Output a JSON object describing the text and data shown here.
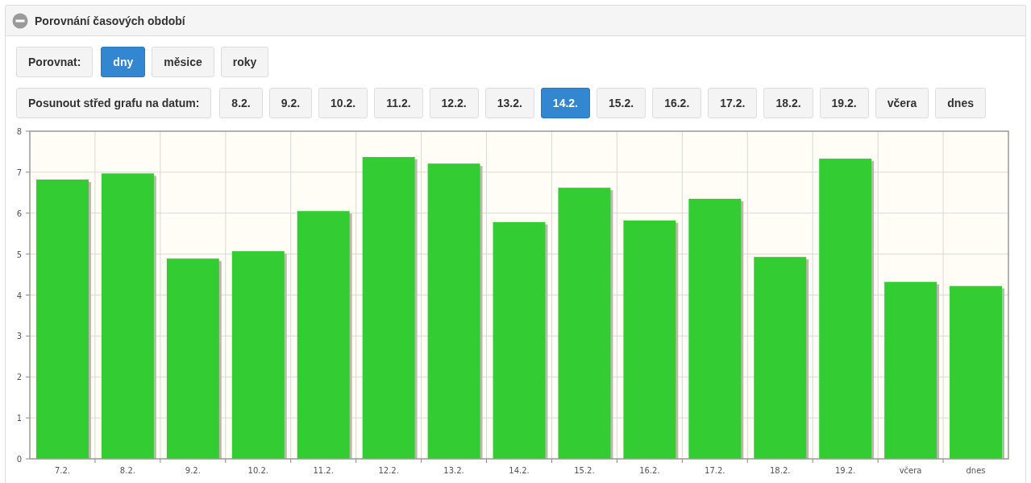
{
  "panel": {
    "title": "Porovnání časových období",
    "expanded": true
  },
  "compare": {
    "label": "Porovnat:",
    "options": [
      {
        "label": "dny",
        "selected": true
      },
      {
        "label": "měsice",
        "selected": false
      },
      {
        "label": "roky",
        "selected": false
      }
    ]
  },
  "shift": {
    "label": "Posunout střed grafu na datum:",
    "dates": [
      {
        "label": "8.2.",
        "selected": false
      },
      {
        "label": "9.2.",
        "selected": false
      },
      {
        "label": "10.2.",
        "selected": false
      },
      {
        "label": "11.2.",
        "selected": false
      },
      {
        "label": "12.2.",
        "selected": false
      },
      {
        "label": "13.2.",
        "selected": false
      },
      {
        "label": "14.2.",
        "selected": true
      },
      {
        "label": "15.2.",
        "selected": false
      },
      {
        "label": "16.2.",
        "selected": false
      },
      {
        "label": "17.2.",
        "selected": false
      },
      {
        "label": "18.2.",
        "selected": false
      },
      {
        "label": "19.2.",
        "selected": false
      },
      {
        "label": "včera",
        "selected": false
      },
      {
        "label": "dnes",
        "selected": false
      }
    ]
  },
  "chart_data": {
    "type": "bar",
    "categories": [
      "7.2.",
      "8.2.",
      "9.2.",
      "10.2.",
      "11.2.",
      "12.2.",
      "13.2.",
      "14.2.",
      "15.2.",
      "16.2.",
      "17.2.",
      "18.2.",
      "19.2.",
      "včera",
      "dnes"
    ],
    "series": [
      {
        "color": "#33cc33",
        "values": [
          6.82,
          6.97,
          4.89,
          5.07,
          6.05,
          7.37,
          7.21,
          5.78,
          6.62,
          5.82,
          6.35,
          4.93,
          7.33,
          4.32,
          4.22
        ]
      }
    ],
    "grid": true,
    "ylim": [
      0,
      8
    ],
    "yticks": [
      0,
      1,
      2,
      3,
      4,
      5,
      6,
      7,
      8
    ]
  }
}
